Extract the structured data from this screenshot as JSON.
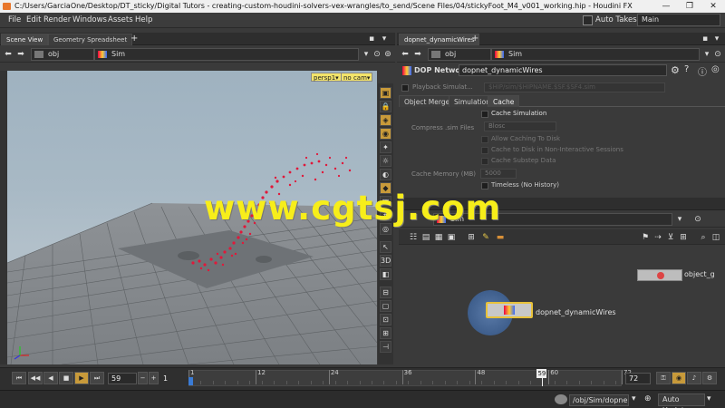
{
  "window": {
    "title": "C:/Users/GarciaOne/Desktop/DT_sticky/Digital Tutors - creating-custom-houdini-solvers-vex-wrangles/to_send/Scene Files/04/stickyFoot_M4_v001_working.hip - Houdini FX",
    "min": "—",
    "max": "❐",
    "close": "✕"
  },
  "menu": {
    "items": [
      "File",
      "Edit",
      "Render",
      "Windows",
      "Assets",
      "Help"
    ],
    "auto_takes": "Auto Takes",
    "desktop": "Main"
  },
  "left": {
    "tabs": [
      "Scene View",
      "Geometry Spreadsheet"
    ],
    "add": "+",
    "path": {
      "obj": "obj",
      "sim": "Sim"
    },
    "viewport": {
      "camera": "persp1▾",
      "cam2": "no cam▾"
    }
  },
  "right": {
    "tab": "dopnet_dynamicWires",
    "add": "+",
    "path": {
      "obj": "obj",
      "sim": "Sim"
    },
    "node_type": "DOP Network",
    "node_name": "dopnet_dynamicWires",
    "playback_label": "Playback Simulat...",
    "playback_path": "$HIP/sim/$HIPNAME.$SF.$SF4.sim",
    "tabs": [
      "Object Merge",
      "Simulation",
      "Cache"
    ],
    "cache": {
      "cache_sim": "Cache Simulation",
      "compress_label": "Compress .sim Files",
      "compress_value": "Blosc",
      "allow_disk": "Allow Caching To Disk",
      "cache_noninteractive": "Cache to Disk in Non-Interactive Sessions",
      "cache_substep": "Cache Substep Data",
      "memory_label": "Cache Memory (MB)",
      "memory_value": "5000",
      "timeless": "Timeless (No History)"
    },
    "net_path": {
      "sim": "Sim"
    },
    "nodes": {
      "main": "dopnet_dynamicWires",
      "other": "object_g"
    }
  },
  "timeline": {
    "frame": "59",
    "start": "1",
    "ticks": [
      "1",
      "12",
      "24",
      "36",
      "48",
      "60",
      "72"
    ],
    "current_tick": "59",
    "end": "72",
    "current_frame": 59,
    "range_start": 1,
    "range_end": 72
  },
  "status": {
    "path": "/obj/Sim/dopne",
    "update": "Auto Update"
  },
  "watermark": "www.cgtsj.com"
}
